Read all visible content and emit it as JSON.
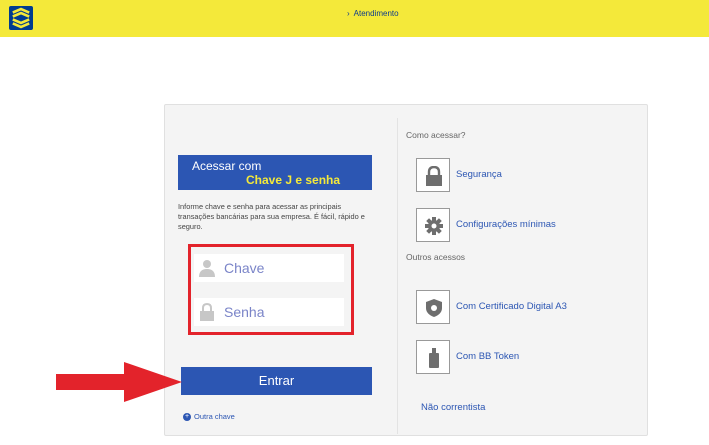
{
  "header": {
    "atendimento_label": "Atendimento",
    "chevron": "›",
    "brand_color": "#f4e93a",
    "logo_color": "#003c8f"
  },
  "login": {
    "title_line1": "Acessar com",
    "title_line2": "Chave J e senha",
    "info_text": "Informe chave e senha para acessar as principais transações bancárias para sua empresa. É fácil, rápido e seguro.",
    "chave_placeholder": "Chave",
    "senha_placeholder": "Senha",
    "entrar_label": "Entrar",
    "outra_chave_label": "Outra chave",
    "outra_chave_icon": "+"
  },
  "sidebar": {
    "como_acessar_heading": "Como acessar?",
    "outros_acessos_heading": "Outros acessos",
    "items": [
      {
        "label": "Segurança",
        "icon": "lock-icon"
      },
      {
        "label": "Configurações mínimas",
        "icon": "gear-icon"
      },
      {
        "label": "Com Certificado Digital A3",
        "icon": "shield-icon"
      },
      {
        "label": "Com BB Token",
        "icon": "token-icon"
      }
    ],
    "nao_correntista_label": "Não correntista"
  },
  "colors": {
    "primary_blue": "#2c56b3",
    "highlight_red": "#e3232b",
    "accent_yellow": "#f4e93a"
  }
}
